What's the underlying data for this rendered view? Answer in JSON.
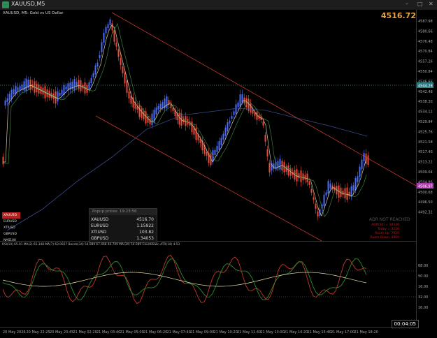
{
  "window": {
    "title": "XAUUSD,M5",
    "min": "–",
    "max": "□",
    "close": "✕"
  },
  "chart": {
    "header": "XAUUSD, M5:  Gold vs US Dollar",
    "price_big": "4516.72",
    "price_tags": [
      "4587.98",
      "4580.66",
      "4576.48",
      "4570.84",
      "4557.26",
      "4550.84",
      "4546.66",
      "4542.48",
      "4538.30",
      "4534.12",
      "4529.94",
      "4525.76",
      "4521.58",
      "4517.40",
      "4513.22",
      "4509.04",
      "4504.86",
      "4500.68",
      "4496.50",
      "4492.32"
    ],
    "tag_blue": "4544.29",
    "tag_magenta": "4506.97",
    "colors": {
      "accent": "#e8a33a",
      "channel": "#c0392b",
      "bull": "#4a6cf7",
      "bear": "#e74c3c"
    }
  },
  "popup": {
    "title": "Popup prices: 19:23:56",
    "rows": [
      {
        "sym": "XAUUSD",
        "val": "4516.70"
      },
      {
        "sym": "EURUSD",
        "val": "1.15922"
      },
      {
        "sym": "XTIUSD",
        "val": "103.82"
      },
      {
        "sym": "GBPUSD",
        "val": "1.34053"
      }
    ]
  },
  "symbols": [
    "XAUUSD",
    "EURUSD",
    "XTIUSD",
    "GBPUSD",
    "NAS100"
  ],
  "adr": {
    "title": "ADR NOT REACHED",
    "lines": [
      "ADR(20) = 10330",
      "Today = 3210",
      "Room Up: 7920",
      "Room Down: 4960"
    ]
  },
  "indicator": {
    "header": "RSI(10) 65.01  MA(2) 65.348  MA(7) 63.0927  Bands(34) 54.089 67.468 40.709  MA(34) 54.089  Countdown  ATR(14) 4.53",
    "tags": [
      "68.00",
      "50.00",
      "16.00",
      "32.00",
      "16.00"
    ]
  },
  "time_axis": [
    "20 May 2026",
    "20 May 22:25",
    "20 May 23:45",
    "21 May 02:20",
    "21 May 03:40",
    "21 May 05:00",
    "21 May 06:20",
    "21 May 07:40",
    "21 May 09:00",
    "21 May 10:20",
    "21 May 11:40",
    "21 May 13:00",
    "21 May 14:20",
    "21 May 15:40",
    "21 May 17:00",
    "21 May 18:20"
  ],
  "countdown": "00:04:05"
}
